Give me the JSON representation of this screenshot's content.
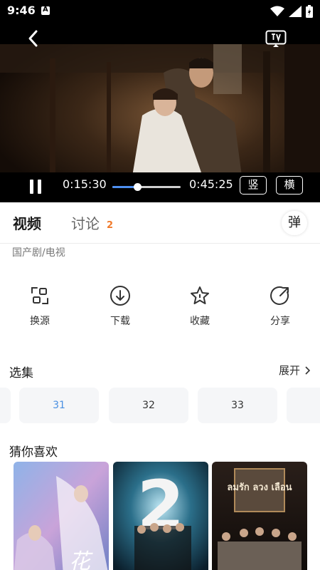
{
  "status_bar": {
    "time": "9:46"
  },
  "player": {
    "current_time": "0:15:30",
    "total_time": "0:45:25",
    "progress": 0.36,
    "portrait_label": "竖",
    "landscape_label": "横"
  },
  "tabs": {
    "video_label": "视频",
    "discuss_label": "讨论",
    "discuss_count": "2",
    "danmaku_label": "弹"
  },
  "genre": "国产剧/电视",
  "actions": [
    {
      "label": "换源",
      "icon": "switch-source-icon"
    },
    {
      "label": "下载",
      "icon": "download-icon"
    },
    {
      "label": "收藏",
      "icon": "star-icon"
    },
    {
      "label": "分享",
      "icon": "share-icon"
    }
  ],
  "episodes": {
    "title": "选集",
    "expand_label": "展开",
    "items": [
      "31",
      "32",
      "33"
    ],
    "active": "31"
  },
  "recommendations": {
    "title": "猜你喜欢",
    "poster_texts": [
      "花",
      "2",
      "ลมรัก ลวง เลือน"
    ]
  },
  "colors": {
    "accent_blue": "#4a90e2",
    "badge_orange": "#f07a2b",
    "progress_blue": "#4d8ff0"
  }
}
